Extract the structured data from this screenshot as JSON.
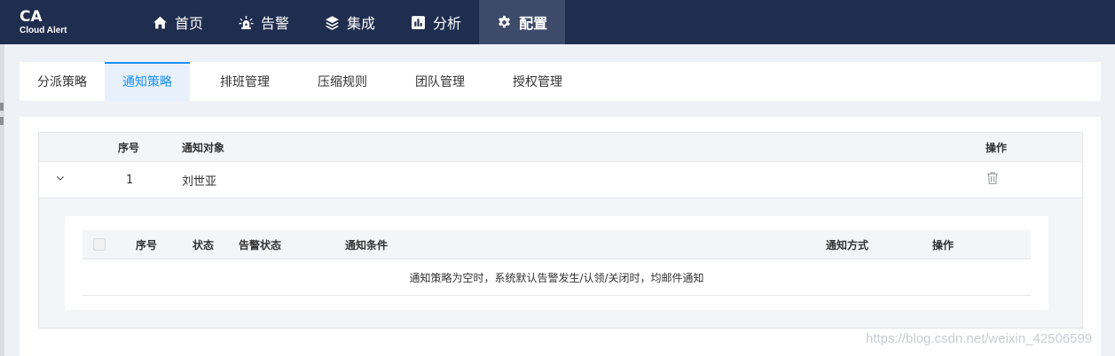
{
  "logo": {
    "main": "CA",
    "sub": "Cloud Alert"
  },
  "nav": [
    {
      "label": "首页",
      "icon": "home-icon"
    },
    {
      "label": "告警",
      "icon": "alarm-light-icon"
    },
    {
      "label": "集成",
      "icon": "layers-icon"
    },
    {
      "label": "分析",
      "icon": "chart-icon"
    },
    {
      "label": "配置",
      "icon": "gear-icon",
      "active": true
    }
  ],
  "tabs": [
    {
      "label": "分派策略"
    },
    {
      "label": "通知策略",
      "active": true
    },
    {
      "label": "排班管理"
    },
    {
      "label": "压缩规则"
    },
    {
      "label": "团队管理"
    },
    {
      "label": "授权管理"
    }
  ],
  "outer_table": {
    "headers": {
      "index": "序号",
      "target": "通知对象",
      "actions": "操作"
    },
    "rows": [
      {
        "index": "1",
        "target": "刘世亚",
        "expand_icon": "chevron-down-icon",
        "action_icon": "trash-icon"
      }
    ]
  },
  "inner_table": {
    "headers": {
      "index": "序号",
      "status": "状态",
      "alarm_status": "告警状态",
      "condition": "通知条件",
      "method": "通知方式",
      "actions": "操作"
    },
    "empty_text": "通知策略为空时，系统默认告警发生/认领/关闭时，均邮件通知"
  },
  "watermark": "https://blog.csdn.net/weixin_42506599",
  "colors": {
    "topbar": "#1f2d4e",
    "active_nav": "#3d4a69",
    "accent": "#1890ff",
    "background": "#eef1f5"
  }
}
